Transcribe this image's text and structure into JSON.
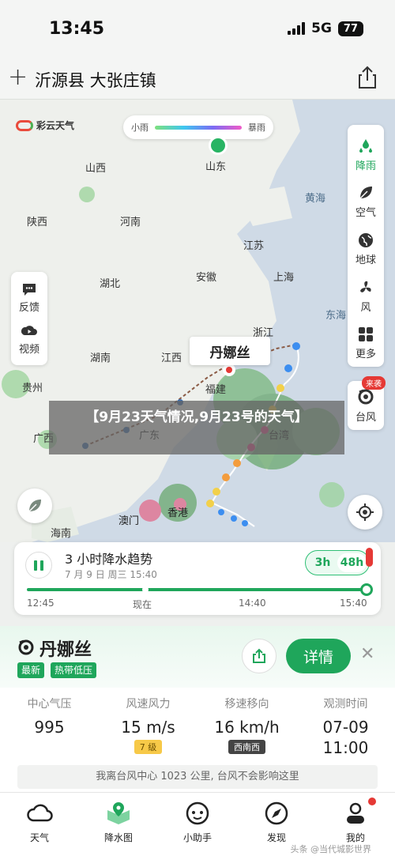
{
  "status": {
    "time": "13:45",
    "network": "5G",
    "battery": "77"
  },
  "header": {
    "title": "沂源县 大张庄镇"
  },
  "map": {
    "brand": "彩云天气",
    "legend_low": "小雨",
    "legend_high": "暴雨",
    "provinces": [
      "山西",
      "山东",
      "陕西",
      "河南",
      "江苏",
      "湖北",
      "安徽",
      "上海",
      "浙江",
      "湖南",
      "江西",
      "贵州",
      "福建",
      "广西",
      "广东",
      "海南"
    ],
    "seas": [
      "黄海",
      "东海"
    ],
    "cities": [
      "台湾",
      "澳门",
      "香港"
    ],
    "layers": [
      {
        "label": "降雨",
        "icon": "rain-icon"
      },
      {
        "label": "空气",
        "icon": "leaf-icon"
      },
      {
        "label": "地球",
        "icon": "globe-icon"
      },
      {
        "label": "风",
        "icon": "fan-icon"
      },
      {
        "label": "更多",
        "icon": "grid-icon"
      }
    ],
    "typhoon_btn": {
      "label": "台风",
      "badge": "来袭"
    },
    "feedback": [
      {
        "label": "反馈",
        "icon": "chat-icon"
      },
      {
        "label": "视频",
        "icon": "play-icon"
      }
    ],
    "typhoon_label": "丹娜丝",
    "overlay_title": "【9月23天气情况,9月23号的天气】"
  },
  "forecast": {
    "title": "3 小时降水趋势",
    "date": "7 月 9 日 周三 15:40",
    "toggle": [
      "3h",
      "48h"
    ],
    "times": [
      "12:45",
      "现在",
      "14:40",
      "15:40"
    ]
  },
  "typhoon": {
    "name": "丹娜丝",
    "tags": [
      "最新",
      "热带低压"
    ],
    "detail": "详情",
    "stats": [
      {
        "label": "中心气压",
        "value": "995"
      },
      {
        "label": "风速风力",
        "value": "15 m/s",
        "sub": "7 级"
      },
      {
        "label": "移速移向",
        "value": "16 km/h",
        "sub": "西南西"
      },
      {
        "label": "观测时间",
        "value": "07-09",
        "sub": "11:00"
      }
    ],
    "notice": "我离台风中心 1023 公里, 台风不会影响这里"
  },
  "tabs": [
    "天气",
    "降水图",
    "小助手",
    "发现",
    "我的"
  ],
  "watermark": "头条 @当代城影世界"
}
